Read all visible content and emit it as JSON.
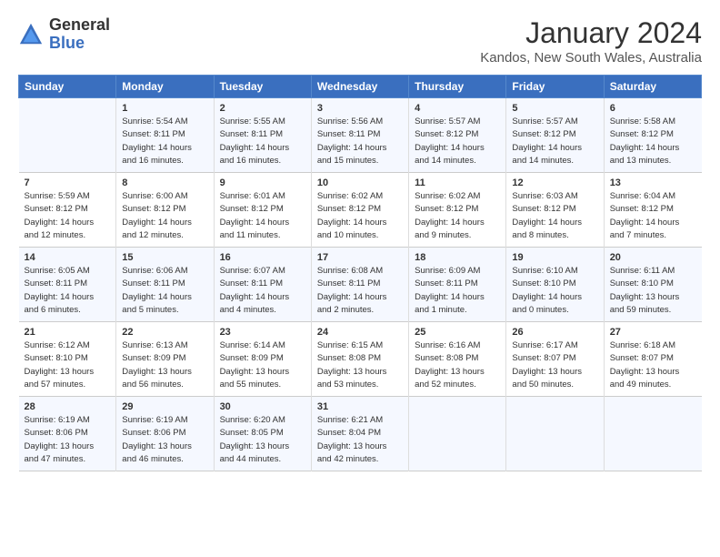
{
  "header": {
    "logo_line1": "General",
    "logo_line2": "Blue",
    "month": "January 2024",
    "location": "Kandos, New South Wales, Australia"
  },
  "days_of_week": [
    "Sunday",
    "Monday",
    "Tuesday",
    "Wednesday",
    "Thursday",
    "Friday",
    "Saturday"
  ],
  "weeks": [
    [
      {
        "day": "",
        "info": ""
      },
      {
        "day": "1",
        "info": "Sunrise: 5:54 AM\nSunset: 8:11 PM\nDaylight: 14 hours\nand 16 minutes."
      },
      {
        "day": "2",
        "info": "Sunrise: 5:55 AM\nSunset: 8:11 PM\nDaylight: 14 hours\nand 16 minutes."
      },
      {
        "day": "3",
        "info": "Sunrise: 5:56 AM\nSunset: 8:11 PM\nDaylight: 14 hours\nand 15 minutes."
      },
      {
        "day": "4",
        "info": "Sunrise: 5:57 AM\nSunset: 8:12 PM\nDaylight: 14 hours\nand 14 minutes."
      },
      {
        "day": "5",
        "info": "Sunrise: 5:57 AM\nSunset: 8:12 PM\nDaylight: 14 hours\nand 14 minutes."
      },
      {
        "day": "6",
        "info": "Sunrise: 5:58 AM\nSunset: 8:12 PM\nDaylight: 14 hours\nand 13 minutes."
      }
    ],
    [
      {
        "day": "7",
        "info": "Sunrise: 5:59 AM\nSunset: 8:12 PM\nDaylight: 14 hours\nand 12 minutes."
      },
      {
        "day": "8",
        "info": "Sunrise: 6:00 AM\nSunset: 8:12 PM\nDaylight: 14 hours\nand 12 minutes."
      },
      {
        "day": "9",
        "info": "Sunrise: 6:01 AM\nSunset: 8:12 PM\nDaylight: 14 hours\nand 11 minutes."
      },
      {
        "day": "10",
        "info": "Sunrise: 6:02 AM\nSunset: 8:12 PM\nDaylight: 14 hours\nand 10 minutes."
      },
      {
        "day": "11",
        "info": "Sunrise: 6:02 AM\nSunset: 8:12 PM\nDaylight: 14 hours\nand 9 minutes."
      },
      {
        "day": "12",
        "info": "Sunrise: 6:03 AM\nSunset: 8:12 PM\nDaylight: 14 hours\nand 8 minutes."
      },
      {
        "day": "13",
        "info": "Sunrise: 6:04 AM\nSunset: 8:12 PM\nDaylight: 14 hours\nand 7 minutes."
      }
    ],
    [
      {
        "day": "14",
        "info": "Sunrise: 6:05 AM\nSunset: 8:11 PM\nDaylight: 14 hours\nand 6 minutes."
      },
      {
        "day": "15",
        "info": "Sunrise: 6:06 AM\nSunset: 8:11 PM\nDaylight: 14 hours\nand 5 minutes."
      },
      {
        "day": "16",
        "info": "Sunrise: 6:07 AM\nSunset: 8:11 PM\nDaylight: 14 hours\nand 4 minutes."
      },
      {
        "day": "17",
        "info": "Sunrise: 6:08 AM\nSunset: 8:11 PM\nDaylight: 14 hours\nand 2 minutes."
      },
      {
        "day": "18",
        "info": "Sunrise: 6:09 AM\nSunset: 8:11 PM\nDaylight: 14 hours\nand 1 minute."
      },
      {
        "day": "19",
        "info": "Sunrise: 6:10 AM\nSunset: 8:10 PM\nDaylight: 14 hours\nand 0 minutes."
      },
      {
        "day": "20",
        "info": "Sunrise: 6:11 AM\nSunset: 8:10 PM\nDaylight: 13 hours\nand 59 minutes."
      }
    ],
    [
      {
        "day": "21",
        "info": "Sunrise: 6:12 AM\nSunset: 8:10 PM\nDaylight: 13 hours\nand 57 minutes."
      },
      {
        "day": "22",
        "info": "Sunrise: 6:13 AM\nSunset: 8:09 PM\nDaylight: 13 hours\nand 56 minutes."
      },
      {
        "day": "23",
        "info": "Sunrise: 6:14 AM\nSunset: 8:09 PM\nDaylight: 13 hours\nand 55 minutes."
      },
      {
        "day": "24",
        "info": "Sunrise: 6:15 AM\nSunset: 8:08 PM\nDaylight: 13 hours\nand 53 minutes."
      },
      {
        "day": "25",
        "info": "Sunrise: 6:16 AM\nSunset: 8:08 PM\nDaylight: 13 hours\nand 52 minutes."
      },
      {
        "day": "26",
        "info": "Sunrise: 6:17 AM\nSunset: 8:07 PM\nDaylight: 13 hours\nand 50 minutes."
      },
      {
        "day": "27",
        "info": "Sunrise: 6:18 AM\nSunset: 8:07 PM\nDaylight: 13 hours\nand 49 minutes."
      }
    ],
    [
      {
        "day": "28",
        "info": "Sunrise: 6:19 AM\nSunset: 8:06 PM\nDaylight: 13 hours\nand 47 minutes."
      },
      {
        "day": "29",
        "info": "Sunrise: 6:19 AM\nSunset: 8:06 PM\nDaylight: 13 hours\nand 46 minutes."
      },
      {
        "day": "30",
        "info": "Sunrise: 6:20 AM\nSunset: 8:05 PM\nDaylight: 13 hours\nand 44 minutes."
      },
      {
        "day": "31",
        "info": "Sunrise: 6:21 AM\nSunset: 8:04 PM\nDaylight: 13 hours\nand 42 minutes."
      },
      {
        "day": "",
        "info": ""
      },
      {
        "day": "",
        "info": ""
      },
      {
        "day": "",
        "info": ""
      }
    ]
  ]
}
